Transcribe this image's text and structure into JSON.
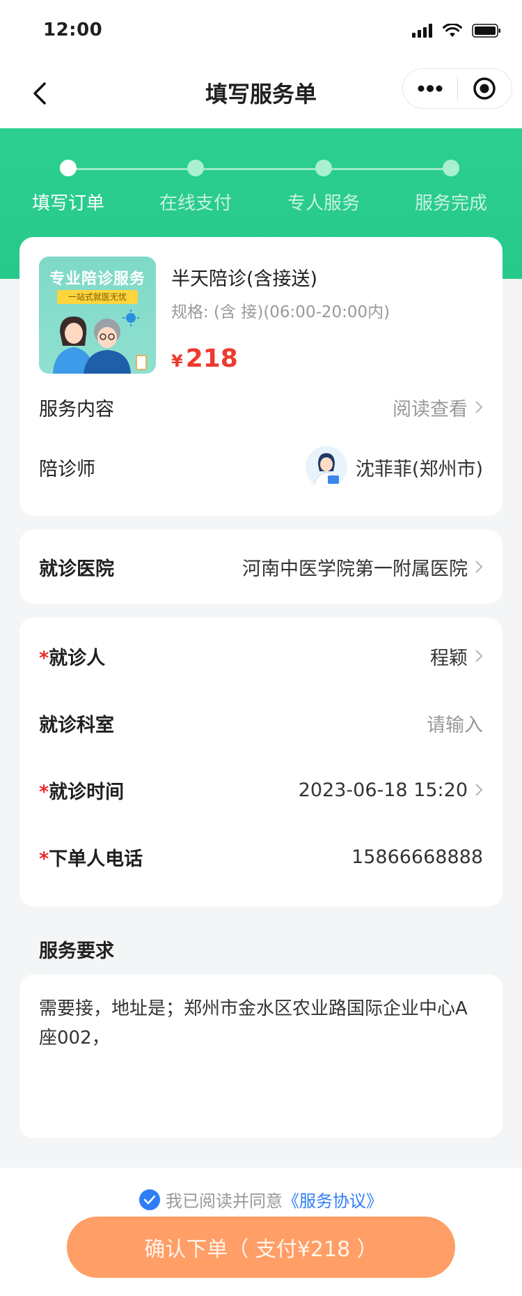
{
  "status_bar": {
    "time": "12:00"
  },
  "nav": {
    "title": "填写服务单"
  },
  "steps": [
    {
      "label": "填写订单",
      "active": true
    },
    {
      "label": "在线支付",
      "active": false
    },
    {
      "label": "专人服务",
      "active": false
    },
    {
      "label": "服务完成",
      "active": false
    }
  ],
  "product": {
    "image_title": "专业陪诊服务",
    "image_tag": "一站式就医无忧",
    "name": "半天陪诊(含接送)",
    "spec": "规格: (含 接)(06:00-20:00内)",
    "currency": "¥",
    "price": "218",
    "service_content_label": "服务内容",
    "service_content_value": "阅读查看",
    "companion_label": "陪诊师",
    "companion_value": "沈菲菲(郑州市)"
  },
  "hospital": {
    "label": "就诊医院",
    "value": "河南中医学院第一附属医院"
  },
  "patient_form": {
    "required_mark": "*",
    "patient_label": "就诊人",
    "patient_value": "程颖",
    "department_label": "就诊科室",
    "department_placeholder": "请输入",
    "time_label": "就诊时间",
    "time_value": "2023-06-18 15:20",
    "phone_label": "下单人电话",
    "phone_value": "15866668888"
  },
  "requirements": {
    "title": "服务要求",
    "text": "需要接，地址是；郑州市金水区农业路国际企业中心A座002，"
  },
  "footer": {
    "agree_text": "我已阅读并同意",
    "agreement_link": "《服务协议》",
    "confirm_button": "确认下单（ 支付¥218 ）"
  },
  "colors": {
    "brand_green": "#2ccf90",
    "price_red": "#ee3a2e",
    "button_orange": "#ff9e66",
    "link_blue": "#2f7df6"
  },
  "icons": [
    "back-arrow-icon",
    "more-dots-icon",
    "target-icon",
    "chevron-right-icon",
    "check-icon",
    "signal-icon",
    "wifi-icon",
    "battery-icon"
  ]
}
